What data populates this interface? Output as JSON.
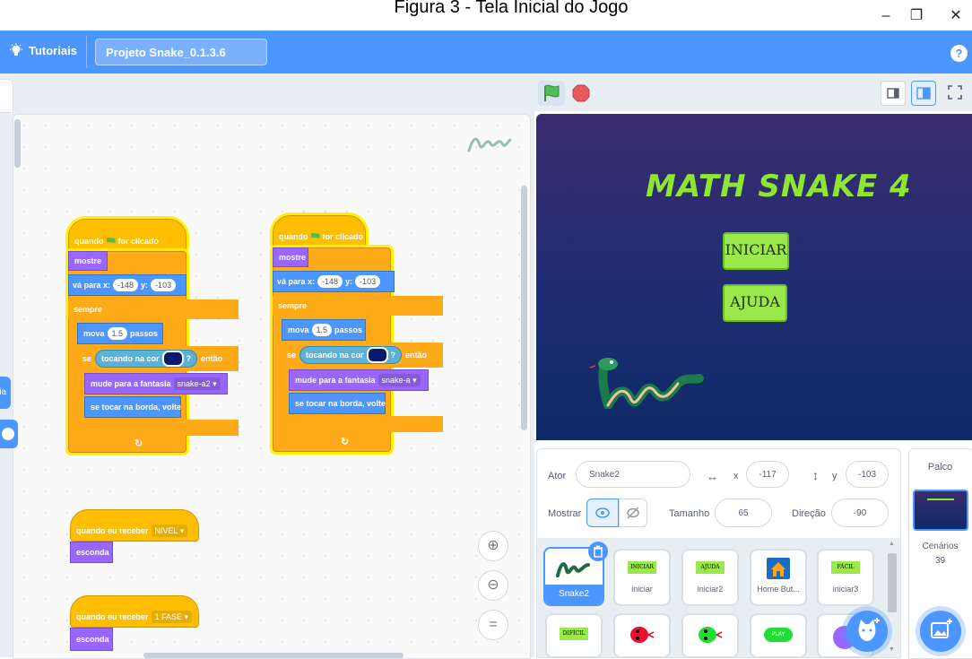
{
  "caption": "Figura 3 - Tela Inicial do Jogo",
  "window": {
    "minimize": "–",
    "maximize": "❐",
    "close": "✕"
  },
  "menubar": {
    "tutorials": "Tutoriais",
    "project_title": "Projeto Snake_0.1.3.6",
    "help": "?"
  },
  "left_category": "ria",
  "scripts": {
    "hat_when_flag": "quando",
    "hat_clicked": "for clicado",
    "show": "mostre",
    "goto": "vá para x:",
    "goto_y": "y:",
    "x_val": "-148",
    "y_val": "-103",
    "forever": "sempre",
    "move": "mova",
    "move_val": "1.5",
    "steps": "passos",
    "if": "se",
    "touching": "tocando na cor",
    "q": "?",
    "then": "então",
    "switch_costume": "mude para a fantasia",
    "costume_a2": "snake-a2 ▾",
    "costume_a": "snake-a ▾",
    "bounce": "se tocar na borda, volte",
    "loop_arrow": "↻",
    "when_receive": "quando eu receber",
    "msg_nivel": "NIVEL ▾",
    "msg_fase": "1 FASE ▾",
    "hide": "esconda"
  },
  "zoom": {
    "in": "⊕",
    "out": "⊖",
    "reset": "="
  },
  "stage": {
    "title": "MATH SNAKE 4",
    "btn_start": "INICIAR",
    "btn_help": "AJUDA"
  },
  "sprite_info": {
    "sprite_label": "Ator",
    "sprite_name": "Snake2",
    "x_label": "x",
    "x_value": "-117",
    "y_label": "y",
    "y_value": "-103",
    "show_label": "Mostrar",
    "size_label": "Tamanho",
    "size_value": "65",
    "direction_label": "Direção",
    "direction_value": "-90"
  },
  "sprites": [
    {
      "name": "Snake2",
      "selected": true
    },
    {
      "name": "iniciar",
      "thumb_text": "INICIAR"
    },
    {
      "name": "iniciar2",
      "thumb_text": "AJUDA"
    },
    {
      "name": "Home But...",
      "thumb_text": ""
    },
    {
      "name": "iniciar3",
      "thumb_text": "FÁCIL"
    }
  ],
  "sprites_row2": [
    {
      "thumb_text": "DIFÍCIL"
    },
    {
      "thumb_text": ""
    },
    {
      "thumb_text": ""
    },
    {
      "thumb_text": "PLAY"
    }
  ],
  "stage_pane": {
    "title": "Palco",
    "backdrops_label": "Cenários",
    "backdrops_count": "39"
  },
  "colors": {
    "menu_blue": "#4c97ff",
    "event": "#ffbf00",
    "control": "#ffab19",
    "looks": "#9966ff",
    "motion": "#4c97ff",
    "sensing": "#5cb1d6",
    "game_green": "#8fe632"
  }
}
